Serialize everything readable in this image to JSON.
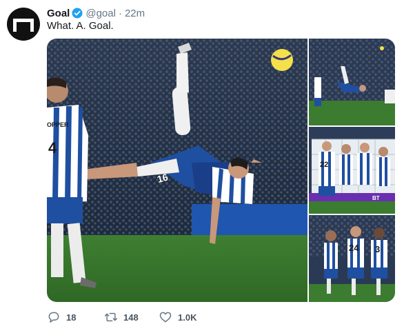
{
  "tweet": {
    "author_name": "Goal",
    "handle": "@goal",
    "separator": "·",
    "time": "22m",
    "text": "What. A. Goal.",
    "verified": true,
    "avatar_icon": "goal-logo-icon"
  },
  "media": {
    "main": {
      "jersey_number": "16",
      "teammate_name": "OPPER",
      "teammate_number": "4"
    },
    "thumb1": {},
    "thumb2": {
      "number_a": "22",
      "ad_text": "BT"
    },
    "thumb3": {
      "number_a": "24",
      "number_b": "3"
    }
  },
  "actions": {
    "replies": "18",
    "retweets": "148",
    "likes": "1.0K",
    "reply_icon": "reply-icon",
    "retweet_icon": "retweet-icon",
    "like_icon": "heart-icon"
  },
  "colors": {
    "text_primary": "#14171a",
    "text_secondary": "#657786",
    "verified_blue": "#1da1f2",
    "pitch_green": "#3d7a2e",
    "kit_blue": "#1f4fa0"
  }
}
